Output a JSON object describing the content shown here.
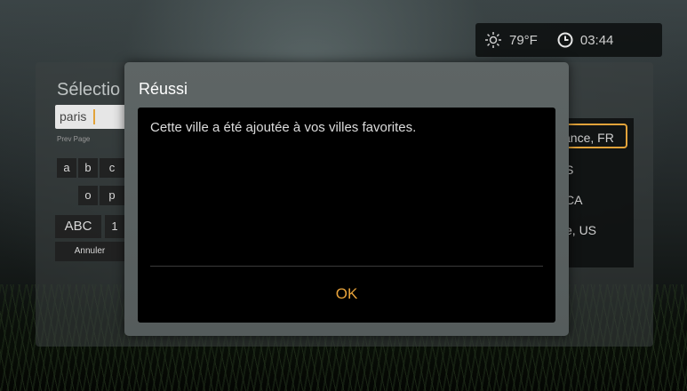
{
  "status": {
    "weather_icon": "sun-icon",
    "temperature": "79°F",
    "clock_icon": "clock-icon",
    "time": "03:44"
  },
  "background_screen": {
    "title_partial": "Sélectio",
    "search_value": "paris",
    "prev_page": "Prev Page",
    "keys_row1": [
      "a",
      "b",
      "c"
    ],
    "keys_row2": [
      "o",
      "p"
    ],
    "mode_key": "ABC",
    "mode_key_partial": "1",
    "cancel": "Annuler",
    "results": [
      "ance, FR",
      "S",
      "CA",
      "e, US"
    ]
  },
  "dialog": {
    "title": "Réussi",
    "message": "Cette ville a été ajoutée à vos villes favorites.",
    "ok_label": "OK"
  },
  "colors": {
    "accent": "#e8a33a"
  }
}
